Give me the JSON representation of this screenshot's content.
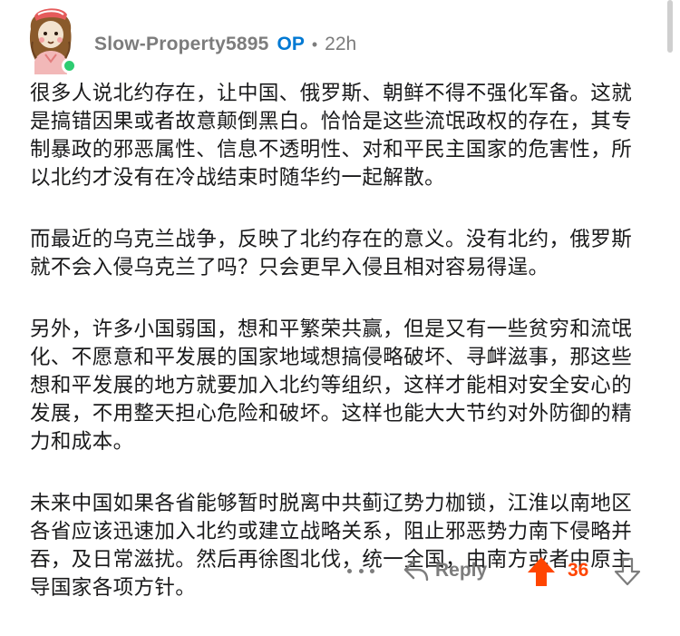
{
  "comment": {
    "author": "Slow-Property5895",
    "op_badge": "OP",
    "separator": "•",
    "time": "22h",
    "paragraphs": [
      "很多人说北约存在，让中国、俄罗斯、朝鲜不得不强化军备。这就是搞错因果或者故意颠倒黑白。恰恰是这些流氓政权的存在，其专制暴政的邪恶属性、信息不透明性、对和平民主国家的危害性，所以北约才没有在冷战结束时随华约一起解散。",
      "而最近的乌克兰战争，反映了北约存在的意义。没有北约，俄罗斯就不会入侵乌克兰了吗？只会更早入侵且相对容易得逞。",
      "另外，许多小国弱国，想和平繁荣共赢，但是又有一些贫穷和流氓化、不愿意和平发展的国家地域想搞侵略破坏、寻衅滋事，那这些想和平发展的地方就要加入北约等组织，这样才能相对安全安心的发展，不用整天担心危险和破坏。这样也能大大节约对外防御的精力和成本。",
      "未来中国如果各省能够暂时脱离中共蓟辽势力枷锁，江淮以南地区各省应该迅速加入北约或建立战略关系，阻止邪恶势力南下侵略并吞，及日常滋扰。然后再徐图北伐，统一全国，由南方或者中原主导国家各项方针。"
    ]
  },
  "actions": {
    "more_icon": "more-horizontal-icon",
    "reply_icon": "reply-arrow-icon",
    "reply_label": "Reply",
    "upvote_icon": "upvote-arrow-icon",
    "score": "36",
    "downvote_icon": "downvote-arrow-icon"
  },
  "colors": {
    "op": "#0079d3",
    "upvoted": "#ff4500",
    "muted": "#7c7c7c",
    "online": "#2ecc71"
  }
}
